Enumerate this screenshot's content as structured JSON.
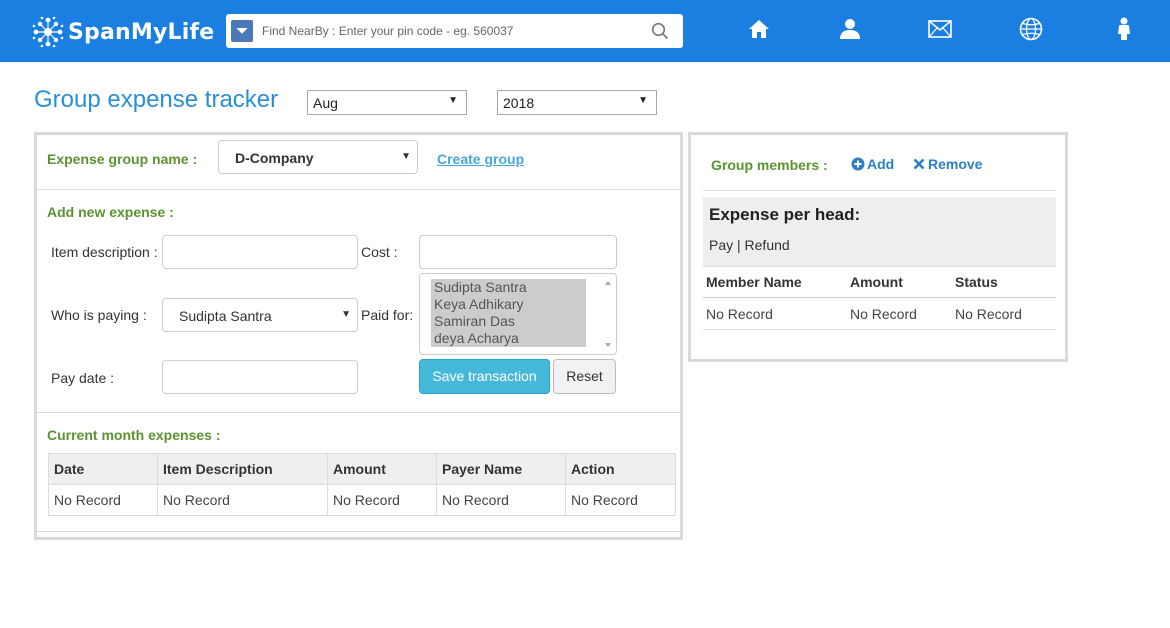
{
  "header": {
    "logo_text": "SpanMyLife",
    "search_placeholder": "Find NearBy : Enter your pin code - eg. 560037",
    "nav_icons": [
      "home-icon",
      "user-icon",
      "mail-icon",
      "globe-icon",
      "person-icon"
    ],
    "brand_color": "#1a7fe0"
  },
  "page": {
    "title": "Group expense tracker",
    "month_select": "Aug",
    "year_select": "2018"
  },
  "expense_form": {
    "group_label": "Expense group name :",
    "group_value": "D-Company",
    "create_group_link": "Create group",
    "add_new_label": "Add new expense :",
    "item_description_label": "Item description :",
    "cost_label": "Cost :",
    "who_paying_label": "Who is paying :",
    "who_paying_value": "Sudipta Santra",
    "paid_for_label": "Paid for:",
    "paid_for_options": [
      "Sudipta Santra",
      "Keya Adhikary",
      "Samiran Das",
      "deya Acharya"
    ],
    "pay_date_label": "Pay date :",
    "save_button": "Save transaction",
    "reset_button": "Reset"
  },
  "current_expenses": {
    "label": "Current month expenses :",
    "columns": [
      "Date",
      "Item Description",
      "Amount",
      "Payer Name",
      "Action"
    ],
    "rows": [
      [
        "No Record",
        "No Record",
        "No Record",
        "No Record",
        "No Record"
      ]
    ]
  },
  "group_members": {
    "label": "Group members :",
    "add_link": "Add",
    "remove_link": "Remove",
    "expense_per_head_title": "Expense per head:",
    "pay_refund": "Pay | Refund",
    "columns": [
      "Member Name",
      "Amount",
      "Status"
    ],
    "rows": [
      [
        "No Record",
        "No Record",
        "No Record"
      ]
    ]
  }
}
